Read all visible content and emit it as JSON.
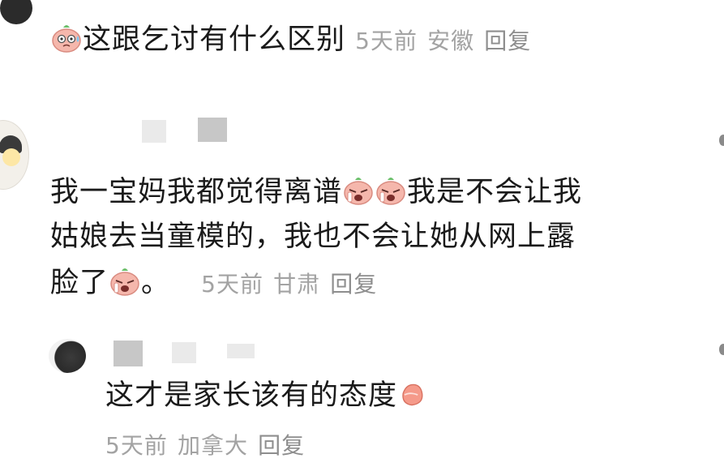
{
  "comments": [
    {
      "text": "这跟乞讨有什么区别",
      "time": "5天前",
      "location": "安徽",
      "reply_label": "回复"
    },
    {
      "line1": "我一宝妈我都觉得离谱",
      "line1_tail": "我是不会让我",
      "line2": "姑娘去当童模的，我也不会让她从网上露",
      "line3": "脸了",
      "line3_tail": "。",
      "time": "5天前",
      "location": "甘肃",
      "reply_label": "回复"
    }
  ],
  "reply": {
    "text": "这才是家长该有的态度",
    "time": "5天前",
    "location": "加拿大",
    "reply_label": "回复"
  },
  "icons": {
    "sweat_emoji": "sweat-face-icon",
    "crying_emoji": "crying-face-icon",
    "thumb_emoji": "thumbs-up-icon"
  },
  "colors": {
    "meta_gray": "#a3a3a3",
    "text": "#1a1a1a",
    "emoji_pink": "#f5b7ac"
  }
}
